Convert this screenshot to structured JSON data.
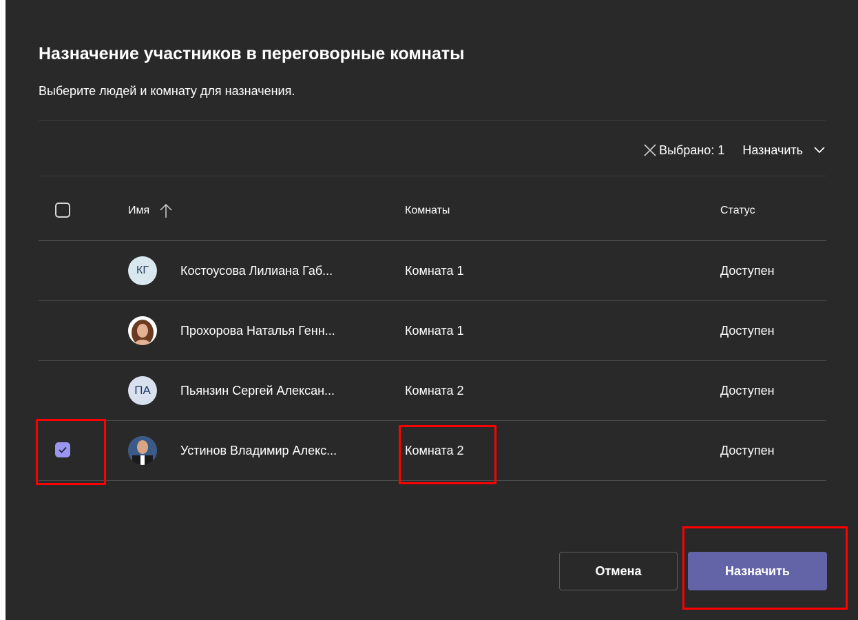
{
  "dialog": {
    "title": "Назначение участников в переговорные комнаты",
    "subtitle": "Выберите людей и комнату для назначения."
  },
  "toolbar": {
    "selected_label": "Выбрано: 1",
    "assign_menu_label": "Назначить",
    "clear_icon": "close-icon",
    "assign_menu_icon": "chevron-down-icon"
  },
  "table": {
    "columns": {
      "name": "Имя",
      "rooms": "Комнаты",
      "status": "Статус"
    },
    "sort_icon": "arrow-up-icon",
    "rows": [
      {
        "initials": "КГ",
        "name": "Костоусова Лилиана Габ...",
        "room": "Комната 1",
        "status": "Доступен",
        "checked": false
      },
      {
        "initials": "",
        "name": "Прохорова Наталья Генн...",
        "room": "Комната 1",
        "status": "Доступен",
        "checked": false
      },
      {
        "initials": "ПА",
        "name": "Пьянзин Сергей Алексан...",
        "room": "Комната 2",
        "status": "Доступен",
        "checked": false
      },
      {
        "initials": "",
        "name": "Устинов Владимир Алекс...",
        "room": "Комната 2",
        "status": "Доступен",
        "checked": true
      }
    ]
  },
  "buttons": {
    "cancel": "Отмена",
    "assign": "Назначить"
  },
  "colors": {
    "background": "#292929",
    "accent": "#6264a7",
    "checkbox_checked": "#9a96f0",
    "highlight": "#ff0000"
  }
}
